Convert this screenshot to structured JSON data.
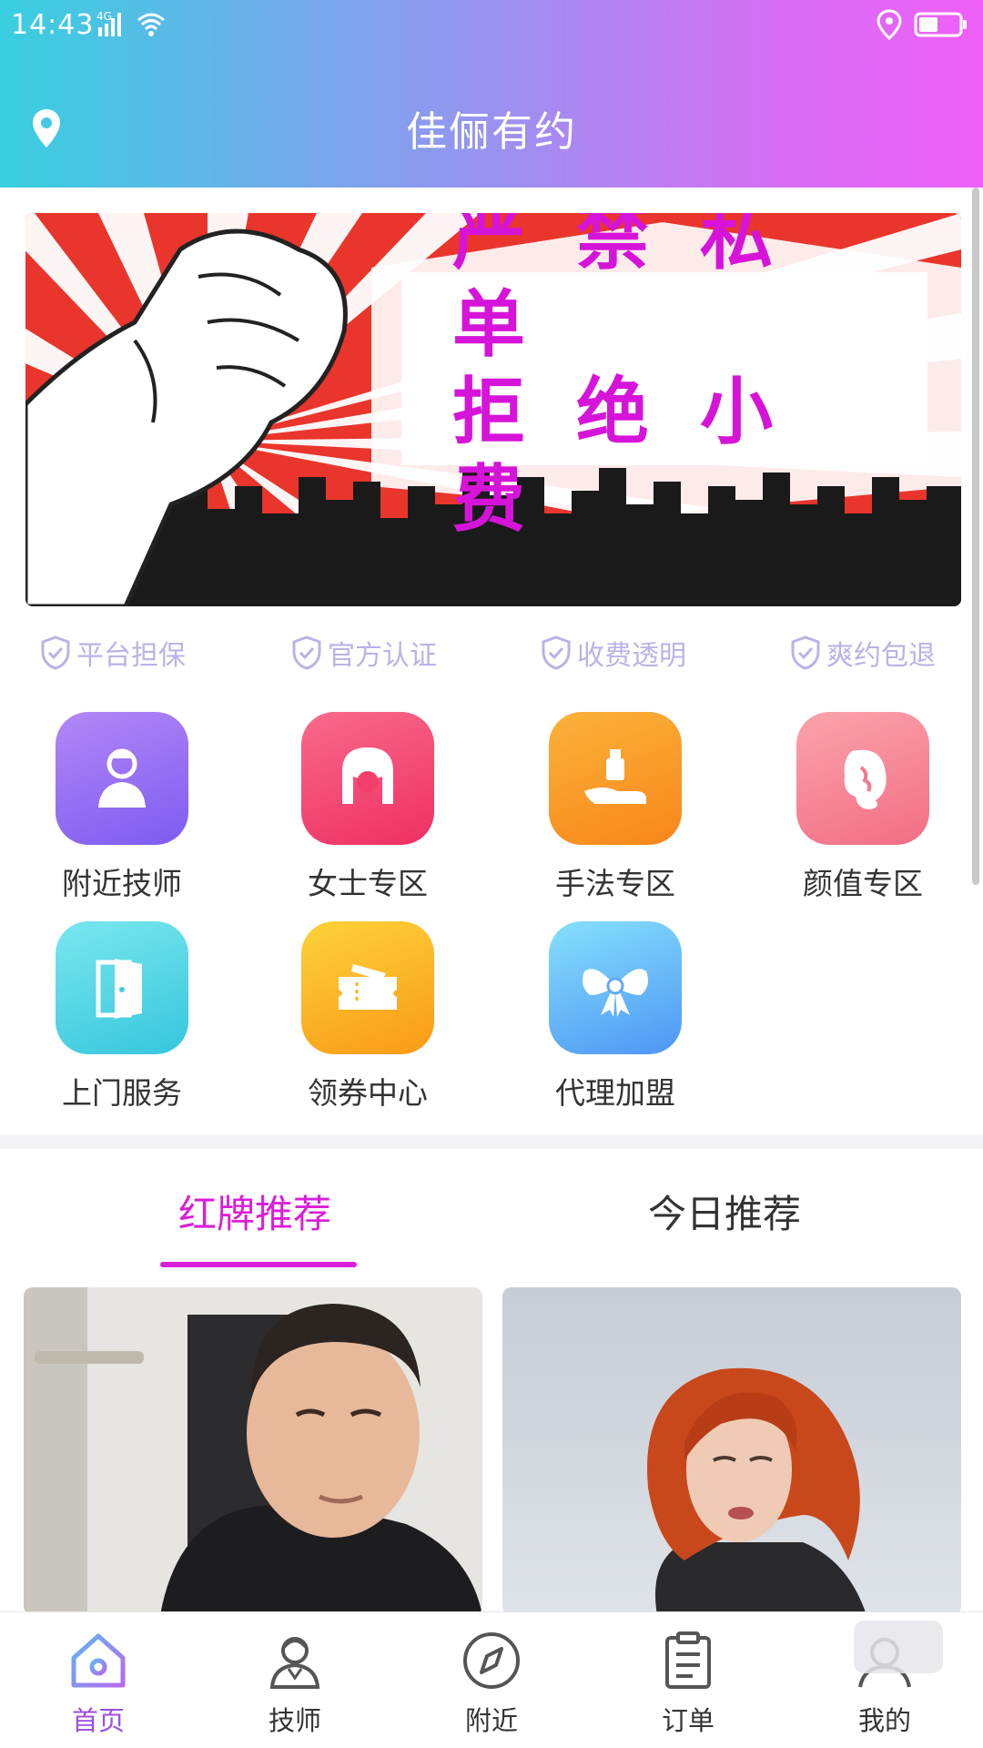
{
  "status_bar": {
    "time": "14:43",
    "network": "4G"
  },
  "header": {
    "title": "佳俪有约"
  },
  "banner": {
    "line1": "严禁私单",
    "line2": "拒绝小费"
  },
  "guarantees": [
    {
      "label": "平台担保"
    },
    {
      "label": "官方认证"
    },
    {
      "label": "收费透明"
    },
    {
      "label": "爽约包退"
    }
  ],
  "categories": [
    {
      "label": "附近技师",
      "icon": "technician-icon",
      "color": "#9a6bf5"
    },
    {
      "label": "女士专区",
      "icon": "lady-icon",
      "color": "#f3496f"
    },
    {
      "label": "手法专区",
      "icon": "massage-oil-icon",
      "color": "#f79a1f"
    },
    {
      "label": "颜值专区",
      "icon": "beauty-icon",
      "color": "#f6869b"
    },
    {
      "label": "上门服务",
      "icon": "door-icon",
      "color": "#4fd6e2"
    },
    {
      "label": "领券中心",
      "icon": "coupon-icon",
      "color": "#fbb21a"
    },
    {
      "label": "代理加盟",
      "icon": "bow-icon",
      "color": "#5eb7f7"
    }
  ],
  "tabs": [
    {
      "label": "红牌推荐",
      "active": true
    },
    {
      "label": "今日推荐",
      "active": false
    }
  ],
  "nav": [
    {
      "label": "首页",
      "icon": "home-icon",
      "active": true
    },
    {
      "label": "技师",
      "icon": "technician-icon",
      "active": false
    },
    {
      "label": "附近",
      "icon": "compass-icon",
      "active": false
    },
    {
      "label": "订单",
      "icon": "order-icon",
      "active": false
    },
    {
      "label": "我的",
      "icon": "profile-icon",
      "active": false
    }
  ],
  "colors": {
    "accent": "#d91fd8",
    "nav_active": "#9b4fe0",
    "guarantee_text": "#b9b3e6"
  }
}
